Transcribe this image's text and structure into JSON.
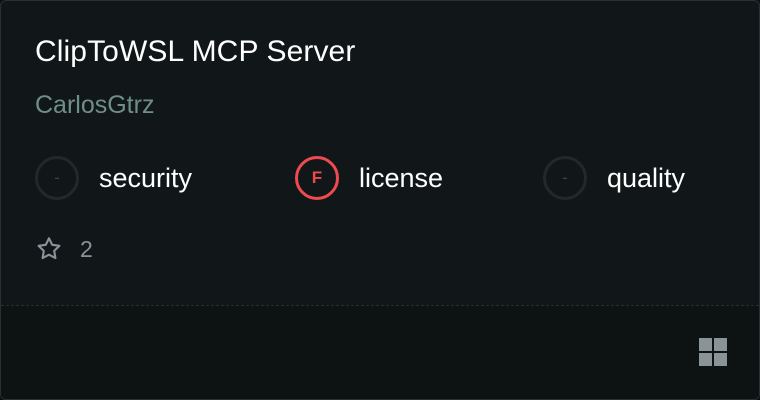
{
  "card": {
    "title": "ClipToWSL MCP Server",
    "author": "CarlosGtrz",
    "scores": [
      {
        "label": "security",
        "grade": "-",
        "status": "none",
        "icon": "dash-badge"
      },
      {
        "label": "license",
        "grade": "F",
        "status": "fail",
        "icon": "grade-badge"
      },
      {
        "label": "quality",
        "grade": "-",
        "status": "none",
        "icon": "dash-badge"
      }
    ],
    "stars": {
      "count": "2",
      "icon": "star-icon"
    },
    "footer": {
      "icon": "grid-icon"
    }
  },
  "colors": {
    "background": "#111719",
    "author": "#6f8f86",
    "fail": "#ef4a4f",
    "muted": "#8a9396"
  }
}
